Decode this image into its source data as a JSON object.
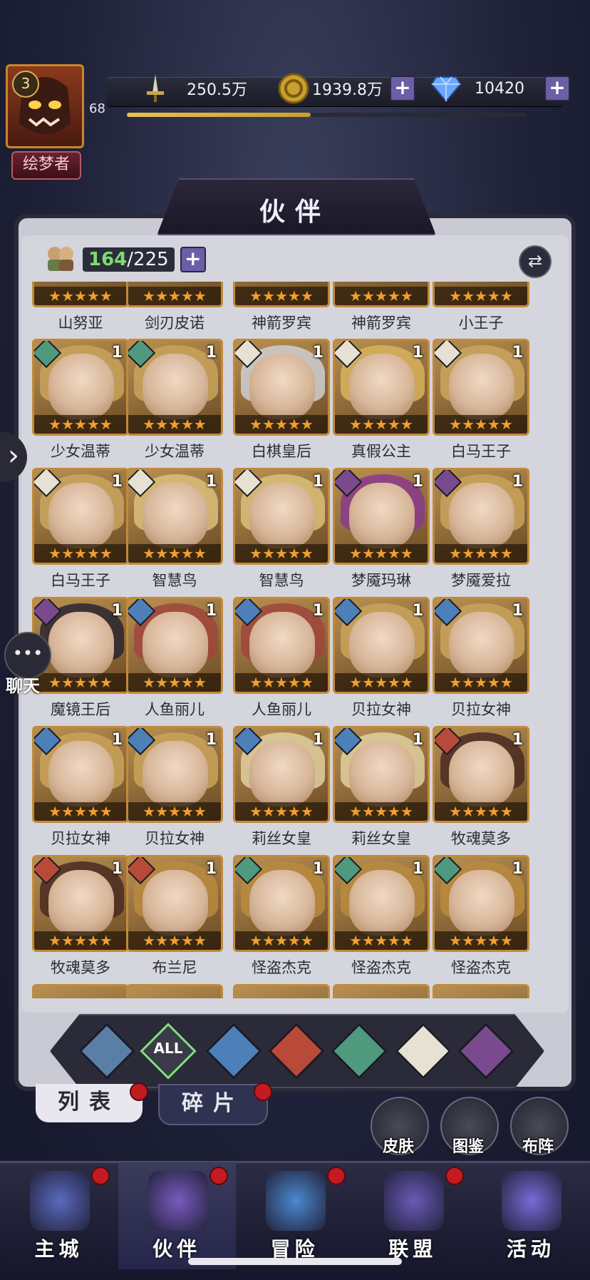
{
  "player": {
    "level_badge": "3",
    "level": "68",
    "title": "绘梦者",
    "exp_fraction": 0.46
  },
  "resources": {
    "power": "250.5万",
    "gold": "1939.8万",
    "diamonds": "10420"
  },
  "panel": {
    "title": "伙伴",
    "owned": "164",
    "separator": "/",
    "capacity": "225"
  },
  "top_row_names": [
    "山努亚",
    "剑刃皮诺",
    "神箭罗宾",
    "神箭罗宾",
    "小王子"
  ],
  "heroes": [
    {
      "name": "少女温蒂",
      "qty": "1",
      "element": "wind",
      "hair": "#c9a35a"
    },
    {
      "name": "少女温蒂",
      "qty": "1",
      "element": "wind",
      "hair": "#c9a35a"
    },
    {
      "name": "白棋皇后",
      "qty": "1",
      "element": "light",
      "hair": "#cfcfd3"
    },
    {
      "name": "真假公主",
      "qty": "1",
      "element": "light",
      "hair": "#d8b35e"
    },
    {
      "name": "白马王子",
      "qty": "1",
      "element": "light",
      "hair": "#caa65e"
    },
    {
      "name": "白马王子",
      "qty": "1",
      "element": "light",
      "hair": "#caa65e"
    },
    {
      "name": "智慧鸟",
      "qty": "1",
      "element": "light",
      "hair": "#dcc07a"
    },
    {
      "name": "智慧鸟",
      "qty": "1",
      "element": "light",
      "hair": "#dcc07a"
    },
    {
      "name": "梦魇玛琳",
      "qty": "1",
      "element": "dark",
      "hair": "#8a3a8c"
    },
    {
      "name": "梦魇爱拉",
      "qty": "1",
      "element": "dark",
      "hair": "#c9a35a"
    },
    {
      "name": "魔镜王后",
      "qty": "1",
      "element": "dark",
      "hair": "#2a2430"
    },
    {
      "name": "人鱼丽儿",
      "qty": "1",
      "element": "water",
      "hair": "#a0453c"
    },
    {
      "name": "人鱼丽儿",
      "qty": "1",
      "element": "water",
      "hair": "#a0453c"
    },
    {
      "name": "贝拉女神",
      "qty": "1",
      "element": "water",
      "hair": "#c9a35a"
    },
    {
      "name": "贝拉女神",
      "qty": "1",
      "element": "water",
      "hair": "#c9a35a"
    },
    {
      "name": "贝拉女神",
      "qty": "1",
      "element": "water",
      "hair": "#c9a35a"
    },
    {
      "name": "贝拉女神",
      "qty": "1",
      "element": "water",
      "hair": "#c9a35a"
    },
    {
      "name": "莉丝女皇",
      "qty": "1",
      "element": "water",
      "hair": "#e0cfa0"
    },
    {
      "name": "莉丝女皇",
      "qty": "1",
      "element": "water",
      "hair": "#e0cfa0"
    },
    {
      "name": "牧魂莫多",
      "qty": "1",
      "element": "fire",
      "hair": "#4a2a22"
    },
    {
      "name": "牧魂莫多",
      "qty": "1",
      "element": "fire",
      "hair": "#4a2a22"
    },
    {
      "name": "布兰尼",
      "qty": "1",
      "element": "fire",
      "hair": "#b8893e"
    },
    {
      "name": "怪盗杰克",
      "qty": "1",
      "element": "wind",
      "hair": "#b8893e"
    },
    {
      "name": "怪盗杰克",
      "qty": "1",
      "element": "wind",
      "hair": "#b8893e"
    },
    {
      "name": "怪盗杰克",
      "qty": "1",
      "element": "wind",
      "hair": "#b8893e"
    }
  ],
  "element_colors": {
    "wind": "#4f9a7e",
    "light": "#e6e1d2",
    "dark": "#7a4a8e",
    "water": "#4d7fb8",
    "fire": "#b94a3a",
    "all": "#3a3a48"
  },
  "filters": [
    {
      "key": "stretch",
      "icon": "water-diamond-icon",
      "label": "",
      "color": "#5a7fa6"
    },
    {
      "key": "all",
      "icon": "all-filter-icon",
      "label": "ALL",
      "color": "#3a3a48"
    },
    {
      "key": "water",
      "icon": "water-drop-icon",
      "label": "",
      "color": "#4d7fb8"
    },
    {
      "key": "fire",
      "icon": "fire-icon",
      "label": "",
      "color": "#b94a3a"
    },
    {
      "key": "wind",
      "icon": "wind-icon",
      "label": "",
      "color": "#4f9a7e"
    },
    {
      "key": "light",
      "icon": "light-star-icon",
      "label": "",
      "color": "#e6e1d2"
    },
    {
      "key": "dark",
      "icon": "dark-eye-icon",
      "label": "",
      "color": "#7a4a8e"
    }
  ],
  "list_tabs": {
    "list": "列表",
    "fragments": "碎片"
  },
  "shortcuts": [
    {
      "label": "皮肤",
      "icon": "skin-icon"
    },
    {
      "label": "图鉴",
      "icon": "codex-icon"
    },
    {
      "label": "布阵",
      "icon": "formation-icon"
    }
  ],
  "chat_label": "聊天",
  "nav": [
    {
      "label": "主城",
      "icon": "castle-icon",
      "badge": true
    },
    {
      "label": "伙伴",
      "icon": "partner-hat-icon",
      "badge": true
    },
    {
      "label": "冒险",
      "icon": "adventure-compass-icon",
      "badge": true
    },
    {
      "label": "联盟",
      "icon": "alliance-shield-icon",
      "badge": true
    },
    {
      "label": "活动",
      "icon": "event-cards-icon",
      "badge": false
    }
  ]
}
